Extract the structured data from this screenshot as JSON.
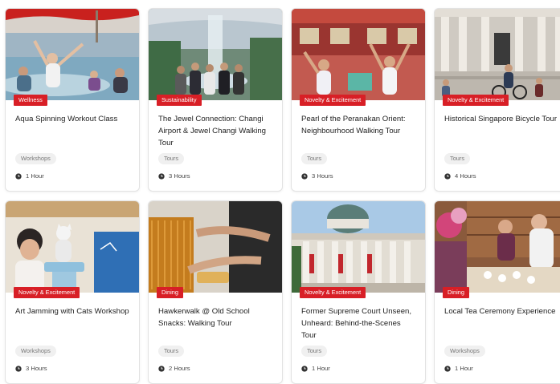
{
  "cards": [
    {
      "category": "Wellness",
      "title": "Aqua Spinning Workout Class",
      "tag": "Workshops",
      "duration": "1 Hour"
    },
    {
      "category": "Sustainability",
      "title": "The Jewel Connection: Changi Airport & Jewel Changi Walking Tour",
      "tag": "Tours",
      "duration": "3 Hours"
    },
    {
      "category": "Novelty & Excitement",
      "title": "Pearl of the Peranakan Orient: Neighbourhood Walking Tour",
      "tag": "Tours",
      "duration": "3 Hours"
    },
    {
      "category": "Novelty & Excitement",
      "title": "Historical Singapore Bicycle Tour",
      "tag": "Tours",
      "duration": "4 Hours"
    },
    {
      "category": "Novelty & Excitement",
      "title": "Art Jamming with Cats Workshop",
      "tag": "Workshops",
      "duration": "3 Hours"
    },
    {
      "category": "Dining",
      "title": "Hawkerwalk @ Old School Snacks: Walking Tour",
      "tag": "Tours",
      "duration": "2 Hours"
    },
    {
      "category": "Novelty & Excitement",
      "title": "Former Supreme Court Unseen, Unheard: Behind-the-Scenes Tour",
      "tag": "Tours",
      "duration": "1 Hour"
    },
    {
      "category": "Dining",
      "title": "Local Tea Ceremony Experience",
      "tag": "Workshops",
      "duration": "1 Hour"
    }
  ],
  "images": [
    "aqua-spinning-photo",
    "jewel-waterfall-photo",
    "peranakan-shophouse-photo",
    "colonial-building-bicycle-photo",
    "cats-art-photo",
    "kueh-snacks-photo",
    "supreme-court-building-photo",
    "tea-ceremony-photo"
  ],
  "colors": {
    "badge": "#d81f26",
    "chip_bg": "#f0f0f0",
    "border": "#e2e2e2"
  },
  "icons": {
    "duration": "clock-icon"
  }
}
